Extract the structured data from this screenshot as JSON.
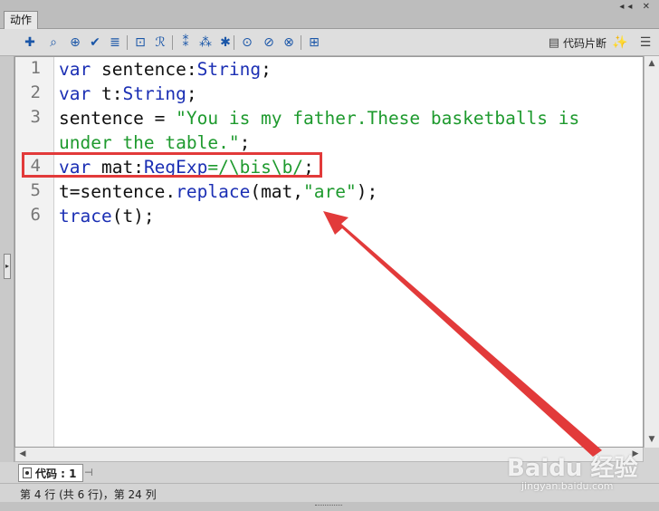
{
  "panel": {
    "title": "动作",
    "controls": "◂◂ ✕"
  },
  "toolbar": {
    "icons": [
      {
        "name": "add-statement-icon",
        "glyph": "✚"
      },
      {
        "name": "find-icon",
        "glyph": "⌕"
      },
      {
        "name": "target-insert-icon",
        "glyph": "⊕"
      },
      {
        "name": "check-syntax-icon",
        "glyph": "✔"
      },
      {
        "name": "auto-format-icon",
        "glyph": "≣"
      },
      {
        "name": "show-code-hint-icon",
        "glyph": "⊡"
      },
      {
        "name": "debug-options-icon",
        "glyph": "ℛ"
      },
      {
        "name": "collapse-between-braces-icon",
        "glyph": "⁑"
      },
      {
        "name": "collapse-selection-icon",
        "glyph": "⁂"
      },
      {
        "name": "expand-all-icon",
        "glyph": "✱"
      },
      {
        "name": "apply-block-comment-icon",
        "glyph": "⊙"
      },
      {
        "name": "apply-line-comment-icon",
        "glyph": "⊘"
      },
      {
        "name": "remove-comment-icon",
        "glyph": "⊗"
      },
      {
        "name": "show-hide-toolbox-icon",
        "glyph": "⊞"
      }
    ],
    "snippet_label": "代码片断",
    "wand_glyph": "✨",
    "menu_glyph": "☰"
  },
  "editor": {
    "line_numbers": [
      "1",
      "2",
      "3",
      "",
      "4",
      "5",
      "6"
    ],
    "lines": [
      [
        {
          "t": "var",
          "c": "kw"
        },
        {
          "t": " sentence:",
          "c": "plain"
        },
        {
          "t": "String",
          "c": "ty"
        },
        {
          "t": ";",
          "c": "plain"
        }
      ],
      [
        {
          "t": "var",
          "c": "kw"
        },
        {
          "t": " t:",
          "c": "plain"
        },
        {
          "t": "String",
          "c": "ty"
        },
        {
          "t": ";",
          "c": "plain"
        }
      ],
      [
        {
          "t": "sentence = ",
          "c": "plain"
        },
        {
          "t": "\"You is my father.These basketballs is",
          "c": "str"
        }
      ],
      [
        {
          "t": "under the table.\"",
          "c": "str"
        },
        {
          "t": ";",
          "c": "plain"
        }
      ],
      [
        {
          "t": "var",
          "c": "kw"
        },
        {
          "t": " mat:",
          "c": "plain"
        },
        {
          "t": "RegExp",
          "c": "ty"
        },
        {
          "t": "=/\\bis\\b/",
          "c": "str"
        },
        {
          "t": ";",
          "c": "plain"
        }
      ],
      [
        {
          "t": "t=sentence.",
          "c": "plain"
        },
        {
          "t": "replace",
          "c": "fn"
        },
        {
          "t": "(mat,",
          "c": "plain"
        },
        {
          "t": "\"are\"",
          "c": "str"
        },
        {
          "t": ");",
          "c": "plain"
        }
      ],
      [
        {
          "t": "trace",
          "c": "fn"
        },
        {
          "t": "(t);",
          "c": "plain"
        }
      ]
    ]
  },
  "bottom_tab": {
    "label": "代码 : 1",
    "pin_glyph": "⊣"
  },
  "status": {
    "text": "第 4 行 (共 6 行)，第 24 列"
  },
  "watermark": {
    "logo": "Baidu 经验",
    "url": "jingyan.baidu.com"
  },
  "colors": {
    "highlight": "#e23a3a",
    "keyword": "#1b2fb4",
    "string": "#1e9a2e"
  }
}
